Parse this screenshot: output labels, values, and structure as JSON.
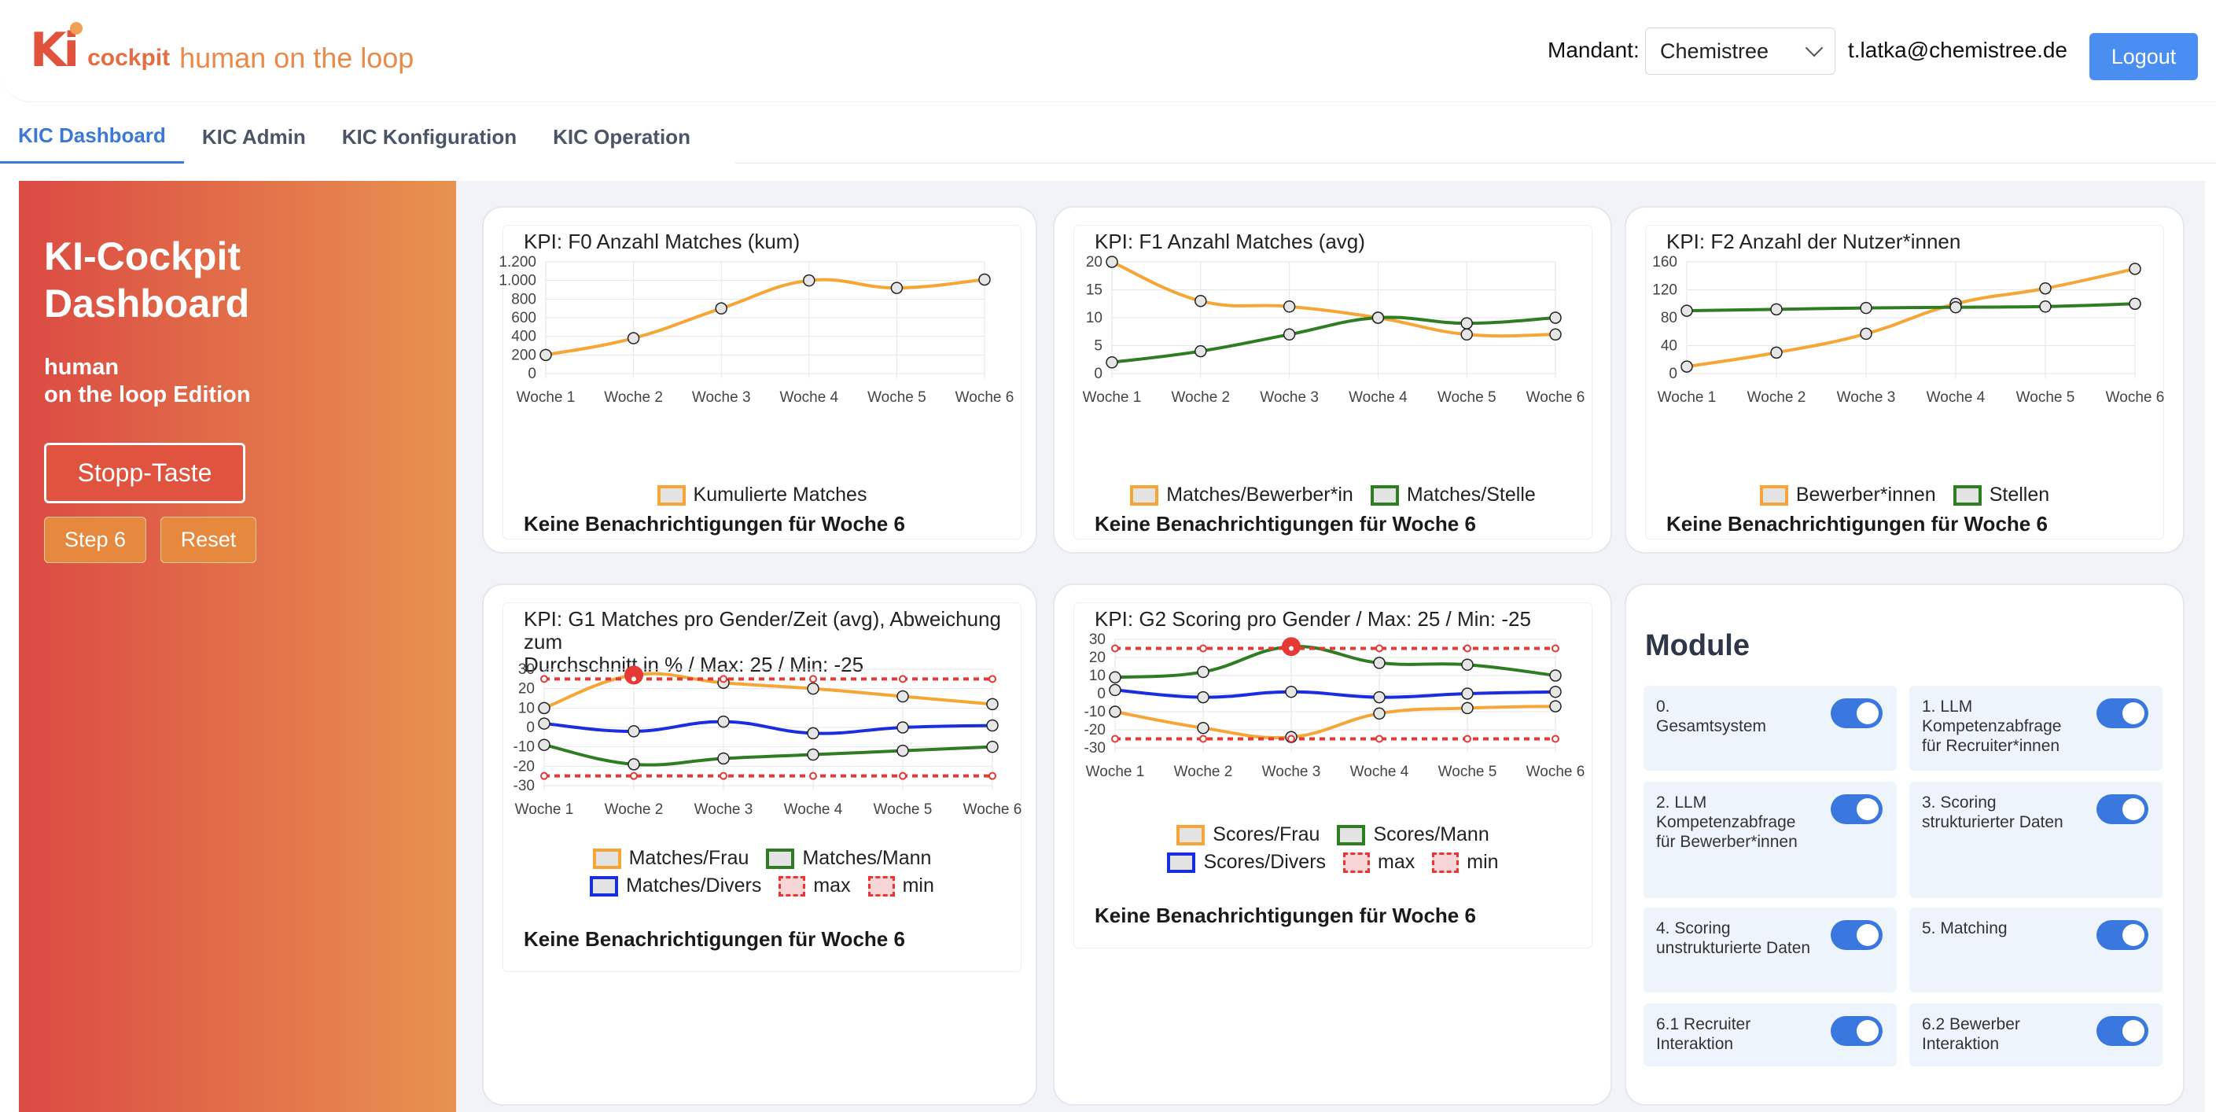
{
  "header": {
    "logo": {
      "mark": "Ki",
      "cockpit": "cockpit",
      "tagline": "human on the loop"
    },
    "mandant_label": "Mandant:",
    "mandant_value": "Chemistree",
    "user_email": "t.latka@chemistree.de",
    "logout_label": "Logout"
  },
  "tabs": [
    "KIC Dashboard",
    "KIC Admin",
    "KIC Konfiguration",
    "KIC Operation"
  ],
  "active_tab": "KIC Dashboard",
  "sidebar": {
    "title_line1": "KI-Cockpit",
    "title_line2": "Dashboard",
    "subtitle_line1": "human",
    "subtitle_line2": "on the loop Edition",
    "stop_button": "Stopp-Taste",
    "step_button": "Step 6",
    "reset_button": "Reset"
  },
  "colors": {
    "accent": "#4a8ef2",
    "orange": "#f5a637",
    "green": "#2e7d23",
    "blue": "#1a2ee0",
    "red": "#e53935"
  },
  "cards": [
    {
      "title_line1": "KPI: F0 Anzahl Matches (kum)",
      "title_line2": "",
      "notification": "Keine Benachrichtigungen für Woche 6",
      "legend": [
        {
          "label": "Kumulierte Matches",
          "color": "#f5a637",
          "dashed": false
        }
      ]
    },
    {
      "title_line1": "KPI: F1 Anzahl Matches (avg)",
      "title_line2": "",
      "notification": "Keine Benachrichtigungen für Woche 6",
      "legend": [
        {
          "label": "Matches/Bewerber*in",
          "color": "#f5a637",
          "dashed": false
        },
        {
          "label": "Matches/Stelle",
          "color": "#2e7d23",
          "dashed": false
        }
      ]
    },
    {
      "title_line1": "KPI: F2 Anzahl der Nutzer*innen",
      "title_line2": "",
      "notification": "Keine Benachrichtigungen für Woche 6",
      "legend": [
        {
          "label": "Bewerber*innen",
          "color": "#f5a637",
          "dashed": false
        },
        {
          "label": "Stellen",
          "color": "#2e7d23",
          "dashed": false
        }
      ]
    },
    {
      "title_line1": "KPI: G1 Matches pro Gender/Zeit (avg), Abweichung zum",
      "title_line2": "Durchschnitt in % / Max: 25 / Min: -25",
      "notification": "Keine Benachrichtigungen für Woche 6",
      "legend": [
        {
          "label": "Matches/Frau",
          "color": "#f5a637",
          "dashed": false
        },
        {
          "label": "Matches/Mann",
          "color": "#2e7d23",
          "dashed": false
        },
        {
          "label": "Matches/Divers",
          "color": "#1a2ee0",
          "dashed": false
        },
        {
          "label": "max",
          "color": "#e53935",
          "dashed": true
        },
        {
          "label": "min",
          "color": "#e53935",
          "dashed": true
        }
      ]
    },
    {
      "title_line1": "KPI: G2 Scoring pro Gender / Max: 25 / Min: -25",
      "title_line2": "",
      "notification": "Keine Benachrichtigungen für Woche 6",
      "legend": [
        {
          "label": "Scores/Frau",
          "color": "#f5a637",
          "dashed": false
        },
        {
          "label": "Scores/Mann",
          "color": "#2e7d23",
          "dashed": false
        },
        {
          "label": "Scores/Divers",
          "color": "#1a2ee0",
          "dashed": false
        },
        {
          "label": "max",
          "color": "#e53935",
          "dashed": true
        },
        {
          "label": "min",
          "color": "#e53935",
          "dashed": true
        }
      ]
    }
  ],
  "chart_data": [
    {
      "type": "line",
      "categories": [
        "Woche 1",
        "Woche 2",
        "Woche 3",
        "Woche 4",
        "Woche 5",
        "Woche 6"
      ],
      "ylim": [
        0,
        1200
      ],
      "yticks": [
        "0",
        "200",
        "400",
        "600",
        "800",
        "1.000",
        "1.200"
      ],
      "ytick_values": [
        0,
        200,
        400,
        600,
        800,
        1000,
        1200
      ],
      "series": [
        {
          "name": "Kumulierte Matches",
          "color": "#f5a637",
          "values": [
            200,
            380,
            700,
            1000,
            920,
            1010
          ]
        }
      ]
    },
    {
      "type": "line",
      "categories": [
        "Woche 1",
        "Woche 2",
        "Woche 3",
        "Woche 4",
        "Woche 5",
        "Woche 6"
      ],
      "ylim": [
        0,
        20
      ],
      "yticks": [
        "0",
        "5",
        "10",
        "15",
        "20"
      ],
      "ytick_values": [
        0,
        5,
        10,
        15,
        20
      ],
      "series": [
        {
          "name": "Matches/Bewerber*in",
          "color": "#f5a637",
          "values": [
            20,
            13,
            12,
            10,
            7,
            7
          ]
        },
        {
          "name": "Matches/Stelle",
          "color": "#2e7d23",
          "values": [
            2,
            4,
            7,
            10,
            9,
            10
          ]
        }
      ]
    },
    {
      "type": "line",
      "categories": [
        "Woche 1",
        "Woche 2",
        "Woche 3",
        "Woche 4",
        "Woche 5",
        "Woche 6"
      ],
      "ylim": [
        0,
        160
      ],
      "yticks": [
        "0",
        "40",
        "80",
        "120",
        "160"
      ],
      "ytick_values": [
        0,
        40,
        80,
        120,
        160
      ],
      "series": [
        {
          "name": "Bewerber*innen",
          "color": "#f5a637",
          "values": [
            10,
            30,
            57,
            100,
            122,
            150
          ]
        },
        {
          "name": "Stellen",
          "color": "#2e7d23",
          "values": [
            90,
            92,
            94,
            95,
            96,
            100
          ]
        }
      ]
    },
    {
      "type": "line",
      "categories": [
        "Woche 1",
        "Woche 2",
        "Woche 3",
        "Woche 4",
        "Woche 5",
        "Woche 6"
      ],
      "ylim": [
        -30,
        30
      ],
      "yticks": [
        "-30",
        "-20",
        "-10",
        "0",
        "10",
        "20",
        "30"
      ],
      "ytick_values": [
        -30,
        -20,
        -10,
        0,
        10,
        20,
        30
      ],
      "series": [
        {
          "name": "Matches/Frau",
          "color": "#f5a637",
          "values": [
            10,
            27,
            23,
            20,
            16,
            12
          ],
          "alert_index": 1
        },
        {
          "name": "Matches/Mann",
          "color": "#2e7d23",
          "values": [
            -9,
            -19,
            -16,
            -14,
            -12,
            -10
          ]
        },
        {
          "name": "Matches/Divers",
          "color": "#1a2ee0",
          "values": [
            2,
            -2,
            3,
            -3,
            0,
            1
          ]
        },
        {
          "name": "max",
          "color": "#e53935",
          "dashed": true,
          "values": [
            25,
            25,
            25,
            25,
            25,
            25
          ]
        },
        {
          "name": "min",
          "color": "#e53935",
          "dashed": true,
          "values": [
            -25,
            -25,
            -25,
            -25,
            -25,
            -25
          ]
        }
      ]
    },
    {
      "type": "line",
      "categories": [
        "Woche 1",
        "Woche 2",
        "Woche 3",
        "Woche 4",
        "Woche 5",
        "Woche 6"
      ],
      "ylim": [
        -30,
        30
      ],
      "yticks": [
        "-30",
        "-20",
        "-10",
        "0",
        "10",
        "20",
        "30"
      ],
      "ytick_values": [
        -30,
        -20,
        -10,
        0,
        10,
        20,
        30
      ],
      "series": [
        {
          "name": "Scores/Frau",
          "color": "#f5a637",
          "values": [
            -10,
            -19,
            -24,
            -11,
            -8,
            -7
          ]
        },
        {
          "name": "Scores/Mann",
          "color": "#2e7d23",
          "values": [
            9,
            12,
            26,
            17,
            16,
            10
          ],
          "alert_index": 2
        },
        {
          "name": "Scores/Divers",
          "color": "#1a2ee0",
          "values": [
            2,
            -2,
            1,
            -2,
            0,
            1
          ]
        },
        {
          "name": "max",
          "color": "#e53935",
          "dashed": true,
          "values": [
            25,
            25,
            25,
            25,
            25,
            25
          ]
        },
        {
          "name": "min",
          "color": "#e53935",
          "dashed": true,
          "values": [
            -25,
            -25,
            -25,
            -25,
            -25,
            -25
          ]
        }
      ]
    }
  ],
  "modules": {
    "title": "Module",
    "items": [
      {
        "label": "0.\nGesamtsystem",
        "enabled": true
      },
      {
        "label": "1. LLM Kompetenzabfrage für Recruiter*innen",
        "enabled": true
      },
      {
        "label": "2. LLM Kompetenzabfrage für Bewerber*innen",
        "enabled": true
      },
      {
        "label": "3. Scoring strukturierter Daten",
        "enabled": true
      },
      {
        "label": "4. Scoring unstrukturierte Daten",
        "enabled": true
      },
      {
        "label": "5. Matching",
        "enabled": true
      },
      {
        "label": "6.1 Recruiter Interaktion",
        "enabled": true
      },
      {
        "label": "6.2 Bewerber Interaktion",
        "enabled": true
      }
    ]
  }
}
